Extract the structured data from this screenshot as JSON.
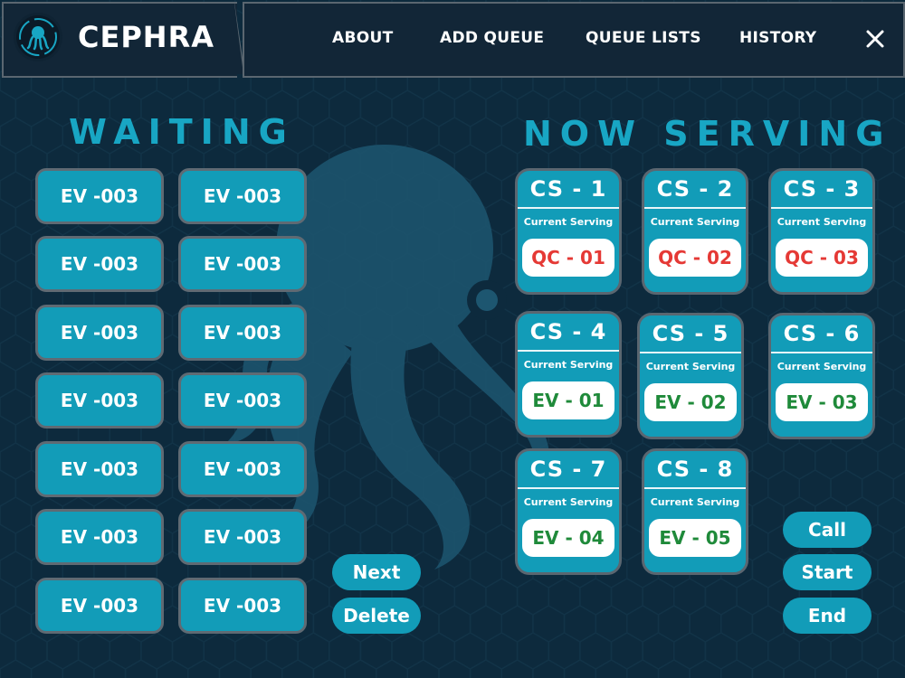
{
  "colors": {
    "background": "#0d2a3d",
    "header": "#122637",
    "accent": "#129cb8",
    "title_accent": "#18a6c4",
    "qc_ticket": "#e53935",
    "ev_ticket": "#1f8a3a"
  },
  "header": {
    "brand": "CEPHRA",
    "logo_icon": "octopus-logo-icon",
    "nav": [
      "ABOUT",
      "ADD QUEUE",
      "QUEUE LISTS",
      "HISTORY"
    ],
    "close_icon": "close-icon"
  },
  "waiting": {
    "title": "WAITING",
    "tickets": [
      "EV -003",
      "EV -003",
      "EV -003",
      "EV -003",
      "EV -003",
      "EV -003",
      "EV -003",
      "EV -003",
      "EV -003",
      "EV -003",
      "EV -003",
      "EV -003",
      "EV -003",
      "EV -003"
    ]
  },
  "serving": {
    "title": "NOW SERVING",
    "counters": [
      {
        "name": "CS - 1",
        "label": "Current Serving",
        "ticket": "QC - 01",
        "ticket_type": "qc"
      },
      {
        "name": "CS - 2",
        "label": "Current Serving",
        "ticket": "QC - 02",
        "ticket_type": "qc"
      },
      {
        "name": "CS - 3",
        "label": "Current Serving",
        "ticket": "QC - 03",
        "ticket_type": "qc"
      },
      {
        "name": "CS - 4",
        "label": "Current Serving",
        "ticket": "EV - 01",
        "ticket_type": "ev"
      },
      {
        "name": "CS - 5",
        "label": "Current Serving",
        "ticket": "EV - 02",
        "ticket_type": "ev"
      },
      {
        "name": "CS - 6",
        "label": "Current Serving",
        "ticket": "EV - 03",
        "ticket_type": "ev"
      },
      {
        "name": "CS - 7",
        "label": "Current Serving",
        "ticket": "EV - 04",
        "ticket_type": "ev"
      },
      {
        "name": "CS - 8",
        "label": "Current Serving",
        "ticket": "EV - 05",
        "ticket_type": "ev"
      }
    ]
  },
  "actions": {
    "next": "Next",
    "delete": "Delete",
    "call": "Call",
    "start": "Start",
    "end": "End"
  }
}
